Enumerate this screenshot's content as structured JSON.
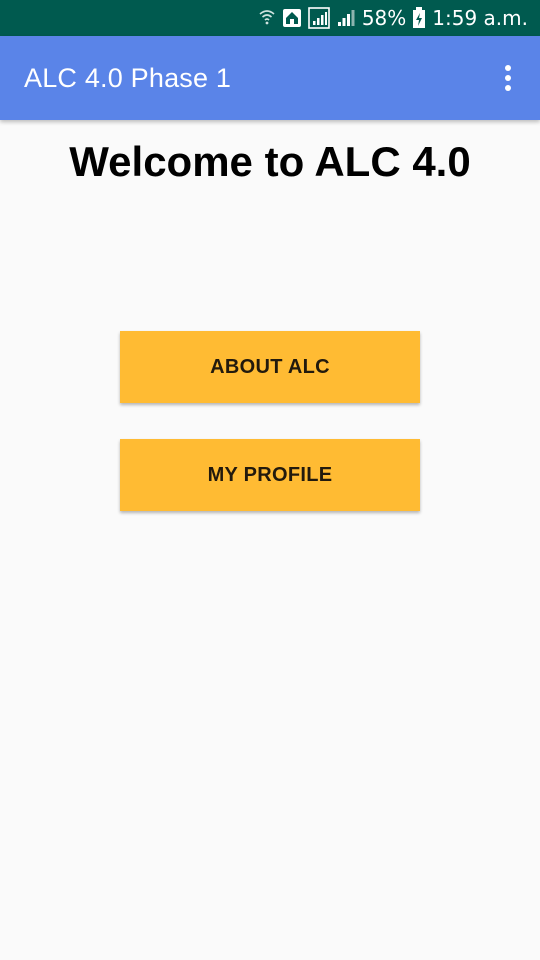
{
  "status_bar": {
    "battery_percent": "58%",
    "time": "1:59 a.m.",
    "icons": [
      "wifi-calling-icon",
      "home-icon",
      "sim-signal-icon",
      "cell-signal-icon",
      "battery-charging-icon"
    ]
  },
  "app_bar": {
    "title": "ALC 4.0 Phase 1",
    "menu_icon": "more-vert-icon"
  },
  "main": {
    "welcome_text": "Welcome to ALC 4.0",
    "buttons": {
      "about_label": "ABOUT ALC",
      "profile_label": "MY PROFILE"
    }
  },
  "colors": {
    "status_bar": "#005a4f",
    "app_bar": "#5a84e8",
    "button": "#ffbb33",
    "background": "#fafafa"
  }
}
